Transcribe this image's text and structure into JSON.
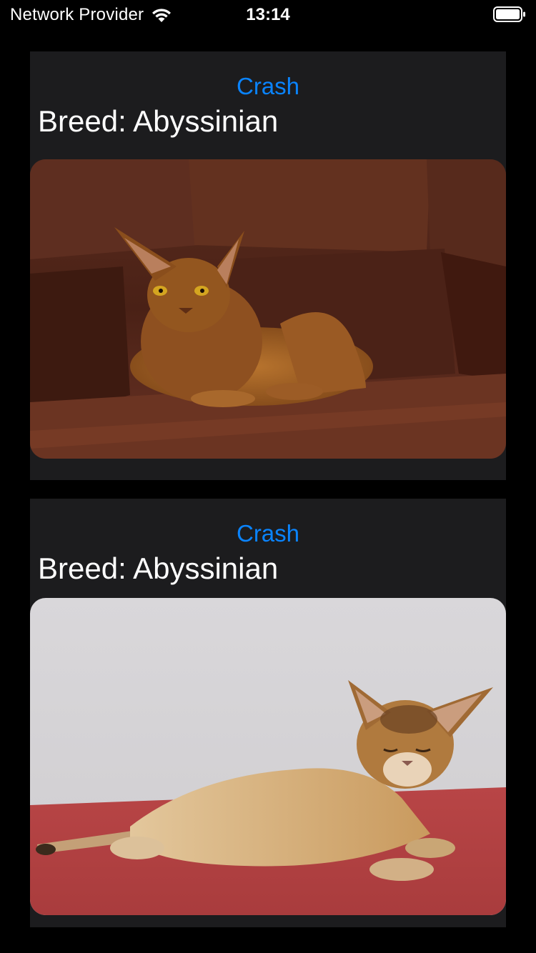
{
  "status_bar": {
    "carrier": "Network Provider",
    "time": "13:14",
    "icons": [
      "wifi-icon",
      "battery-icon"
    ]
  },
  "colors": {
    "background": "#000000",
    "card": "#1c1c1e",
    "accent": "#0a84ff",
    "text": "#ffffff"
  },
  "cards": [
    {
      "button_label": "Crash",
      "breed_text": "Breed: Abyssinian",
      "photo": "abyssinian-cat-on-brown-leather-sofa"
    },
    {
      "button_label": "Crash",
      "breed_text": "Breed: Abyssinian",
      "photo": "abyssinian-kitten-lying-on-red-surface"
    }
  ]
}
